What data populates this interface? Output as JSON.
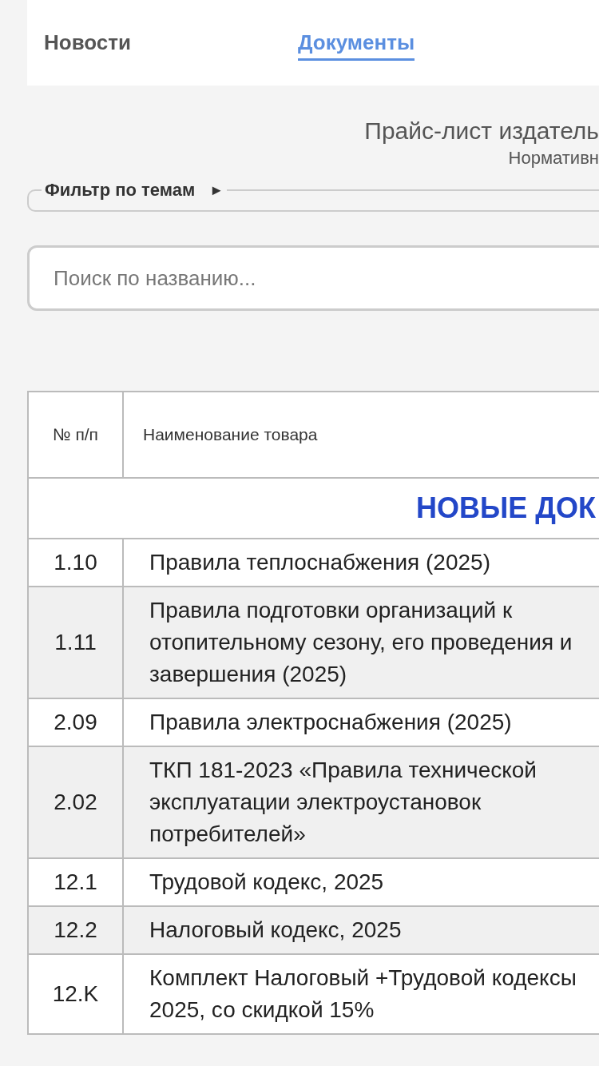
{
  "nav": [
    {
      "label": "Новости",
      "selected": false
    },
    {
      "label": "Документы",
      "selected": true
    }
  ],
  "title": "Прайс-лист издатель",
  "subtitle": "Нормативн",
  "filter": {
    "label": "Фильтр по темам",
    "toggle": "►"
  },
  "search": {
    "placeholder": "Поиск по названию..."
  },
  "table": {
    "columns": [
      "№ п/п",
      "Наименование товара"
    ],
    "section": "НОВЫЕ ДОК",
    "rows": [
      {
        "num": "1.10",
        "name": "Правила теплоснабжения (2025)"
      },
      {
        "num": "1.11",
        "name": "Правила подготовки организаций к отопительному сезону, его проведения и завершения (2025)"
      },
      {
        "num": "2.09",
        "name": "Правила электроснабжения (2025)"
      },
      {
        "num": "2.02",
        "name": "ТКП 181-2023 «Правила технической эксплуатации электроустановок потребителей»"
      },
      {
        "num": "12.1",
        "name": "Трудовой кодекс, 2025"
      },
      {
        "num": "12.2",
        "name": "Налоговый кодекс, 2025"
      },
      {
        "num": "12.K",
        "name": "Комплект Налоговый +Трудовой кодексы 2025, со скидкой 15%"
      }
    ]
  }
}
